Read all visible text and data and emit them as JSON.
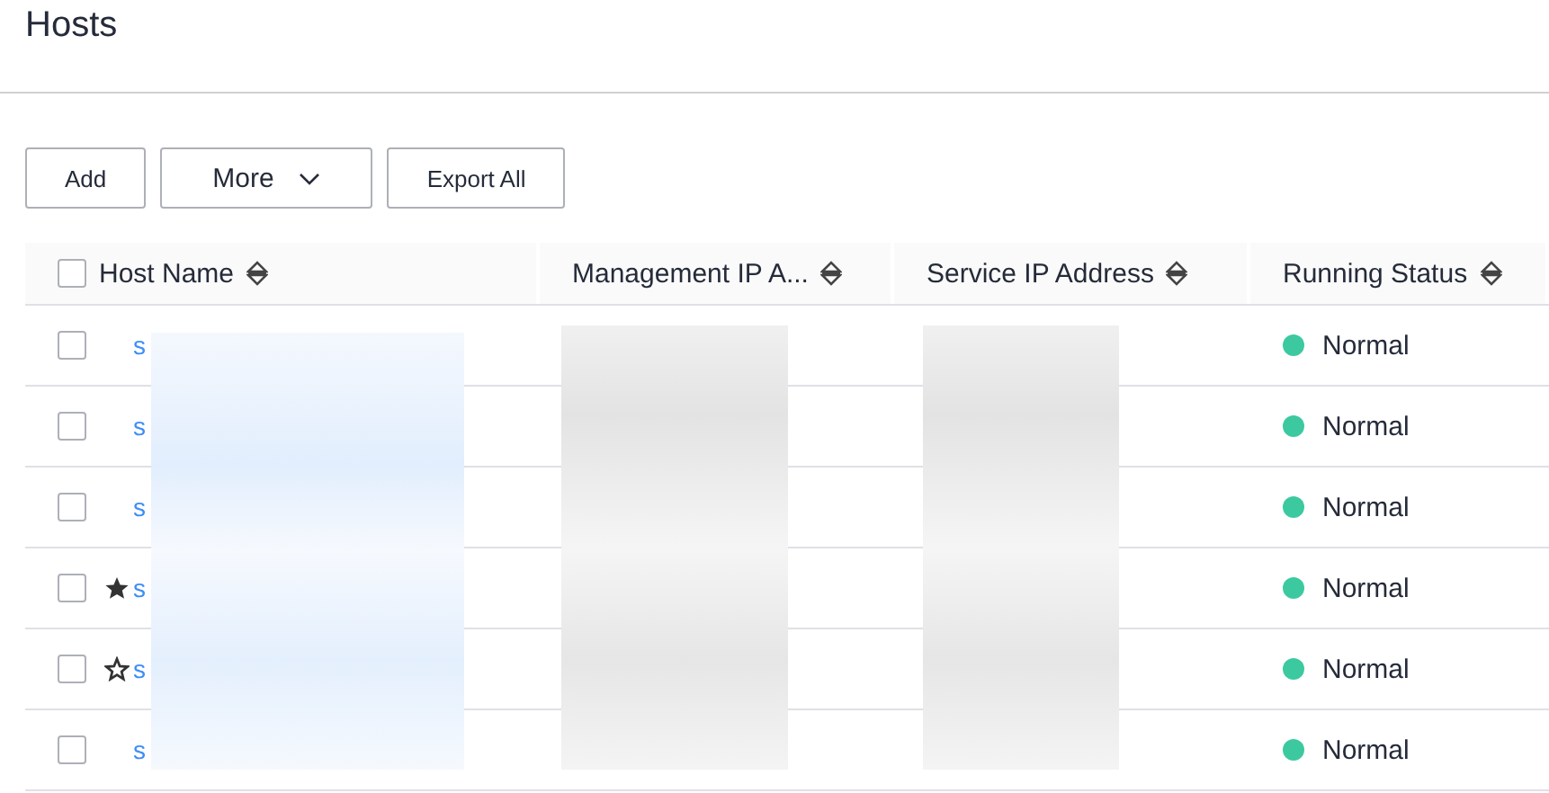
{
  "page": {
    "title": "Hosts"
  },
  "toolbar": {
    "buttons": [
      {
        "label": "Add",
        "kind": "plain"
      },
      {
        "label": "More",
        "kind": "dropdown"
      },
      {
        "label": "Export All",
        "kind": "plain"
      }
    ]
  },
  "table": {
    "select_all": {
      "checked": false
    },
    "columns": [
      {
        "label": "Host Name"
      },
      {
        "label": "Management IP A..."
      },
      {
        "label": "Service IP Address"
      },
      {
        "label": "Running Status"
      }
    ],
    "rows": [
      {
        "checked": false,
        "kind": "plain",
        "host_name": "s",
        "status": "Normal",
        "color": "#3dc9a0"
      },
      {
        "checked": false,
        "kind": "plain",
        "host_name": "s",
        "status": "Normal",
        "color": "#3dc9a0"
      },
      {
        "checked": false,
        "kind": "plain",
        "host_name": "s",
        "status": "Normal",
        "color": "#3dc9a0"
      },
      {
        "checked": false,
        "kind": "starred",
        "host_name": "s",
        "status": "Normal",
        "color": "#3dc9a0"
      },
      {
        "checked": false,
        "kind": "unstarred",
        "host_name": "s",
        "status": "Normal",
        "color": "#3dc9a0"
      },
      {
        "checked": false,
        "kind": "plain",
        "host_name": "s",
        "status": "Normal",
        "color": "#3dc9a0"
      }
    ]
  }
}
